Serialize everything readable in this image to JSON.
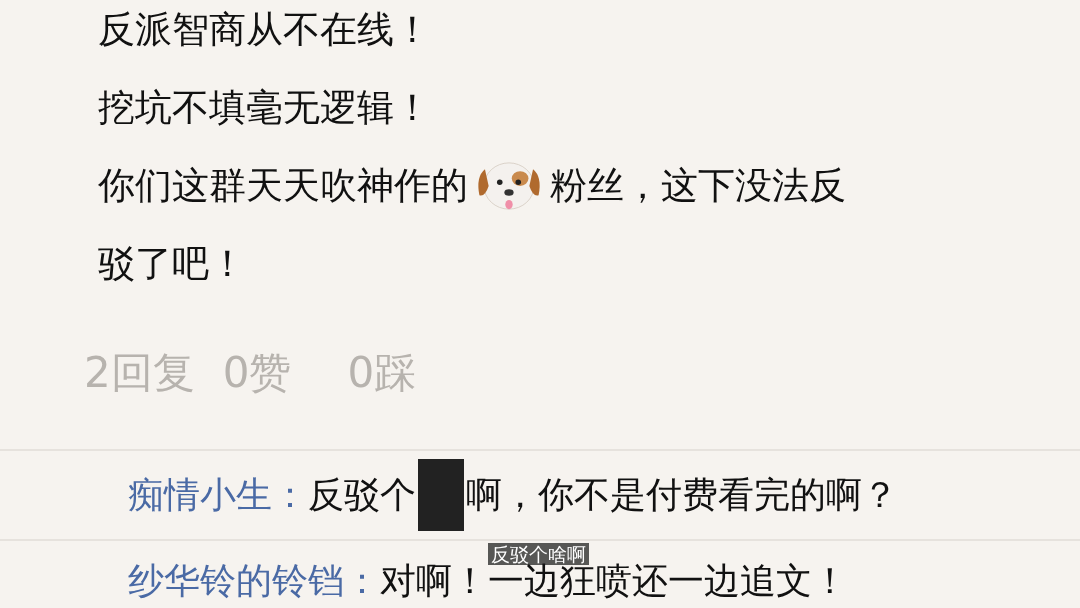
{
  "post": {
    "lines": [
      {
        "kind": "plain",
        "text": "反派智商从不在线！"
      },
      {
        "kind": "plain",
        "text": "挖坑不填毫无逻辑！"
      },
      {
        "kind": "with_icon",
        "text": "你们这群天天吹神作的",
        "text_after": "粉丝，这下没法反"
      },
      {
        "kind": "plain",
        "text": "驳了吧！"
      }
    ]
  },
  "stats": {
    "replies": "2回复",
    "likes": "0赞",
    "dislikes": "0踩"
  },
  "replies": [
    {
      "user": "痴情小生：",
      "text": "反驳个",
      "censored": true,
      "text_after": "啊，你不是付费看完的啊？"
    },
    {
      "user": "纱华铃的铃铛：",
      "text": "对啊！一边狂喷还一边追文！",
      "censored": false
    }
  ],
  "subtitle": "反驳个啥啊"
}
